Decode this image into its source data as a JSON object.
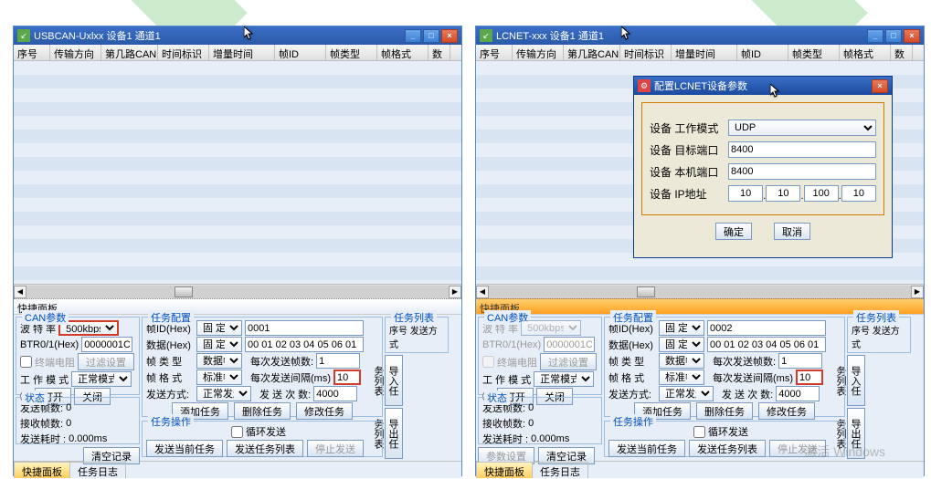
{
  "win1": {
    "title": "USBCAN-Uxlxx 设备1 通道1"
  },
  "win2": {
    "title": "LCNET-xxx 设备1 通道1"
  },
  "headers": [
    "序号",
    "传输方向",
    "第几路CAN",
    "时间标识",
    "增量时间",
    "帧ID",
    "帧类型",
    "帧格式",
    "数"
  ],
  "quick_panel": "快捷面板",
  "can_params": "CAN参数",
  "baud_label": "波 特 率",
  "baud_value": "500kbps",
  "btr_label": "BTR0/1(Hex)",
  "btr_value": "0000001C",
  "term_res": "终端电阻",
  "filter_btn": "过滤设置",
  "workmode_label": "工 作 模 式",
  "workmode_value": "正常模式",
  "open_btn": "打开",
  "close_btn": "关闭",
  "status": "状态",
  "send_cnt_label": "发送帧数:",
  "recv_cnt_label": "接收帧数:",
  "time_label": "发送耗时 :",
  "zero": "0",
  "time_value": "0.000ms",
  "clear_btn": "清空记录",
  "task_cfg": "任务配置",
  "frame_id_label": "帧ID(Hex)",
  "fixed": "固 定",
  "frame_id1": "0001",
  "frame_id2": "0002",
  "data_label": "数据(Hex)",
  "data_value": "00 01 02 03 04 05 06 01",
  "frame_type_label": "帧 类 型",
  "frame_type_value": "数据帧",
  "per_send_label": "每次发送帧数:",
  "per_send_value": "1",
  "frame_fmt_label": "帧 格 式",
  "frame_fmt_value": "标准帧",
  "interval_label": "每次发送间隔(ms)",
  "interval_value": "10",
  "send_mode_label": "发送方式:",
  "send_mode_value": "正常发送",
  "send_times_label": "发 送 次 数:",
  "send_times_value": "4000",
  "add_task": "添加任务",
  "del_task": "删除任务",
  "mod_task": "修改任务",
  "task_ops": "任务操作",
  "loop_send": "循环发送",
  "send_cur": "发送当前任务",
  "send_list": "发送任务列表",
  "stop_send": "停止发送",
  "task_list": "任务列表",
  "list_head": "序号    发送方式",
  "import_btn": "导入任务列表",
  "export_btn": "导出任务列表",
  "param_cfg": "参数设置",
  "tab1": "快捷面板",
  "tab2": "任务日志",
  "dlg": {
    "title": "配置LCNET设备参数",
    "mode_label": "设备 工作模式",
    "mode_value": "UDP",
    "target_port_label": "设备 目标端口",
    "target_port": "8400",
    "local_port_label": "设备 本机端口",
    "local_port": "8400",
    "ip_label": "设备 IP地址",
    "ip": [
      "10",
      "10",
      "100",
      "10"
    ],
    "ok": "确定",
    "cancel": "取消"
  },
  "watermark": "激活 Windows"
}
